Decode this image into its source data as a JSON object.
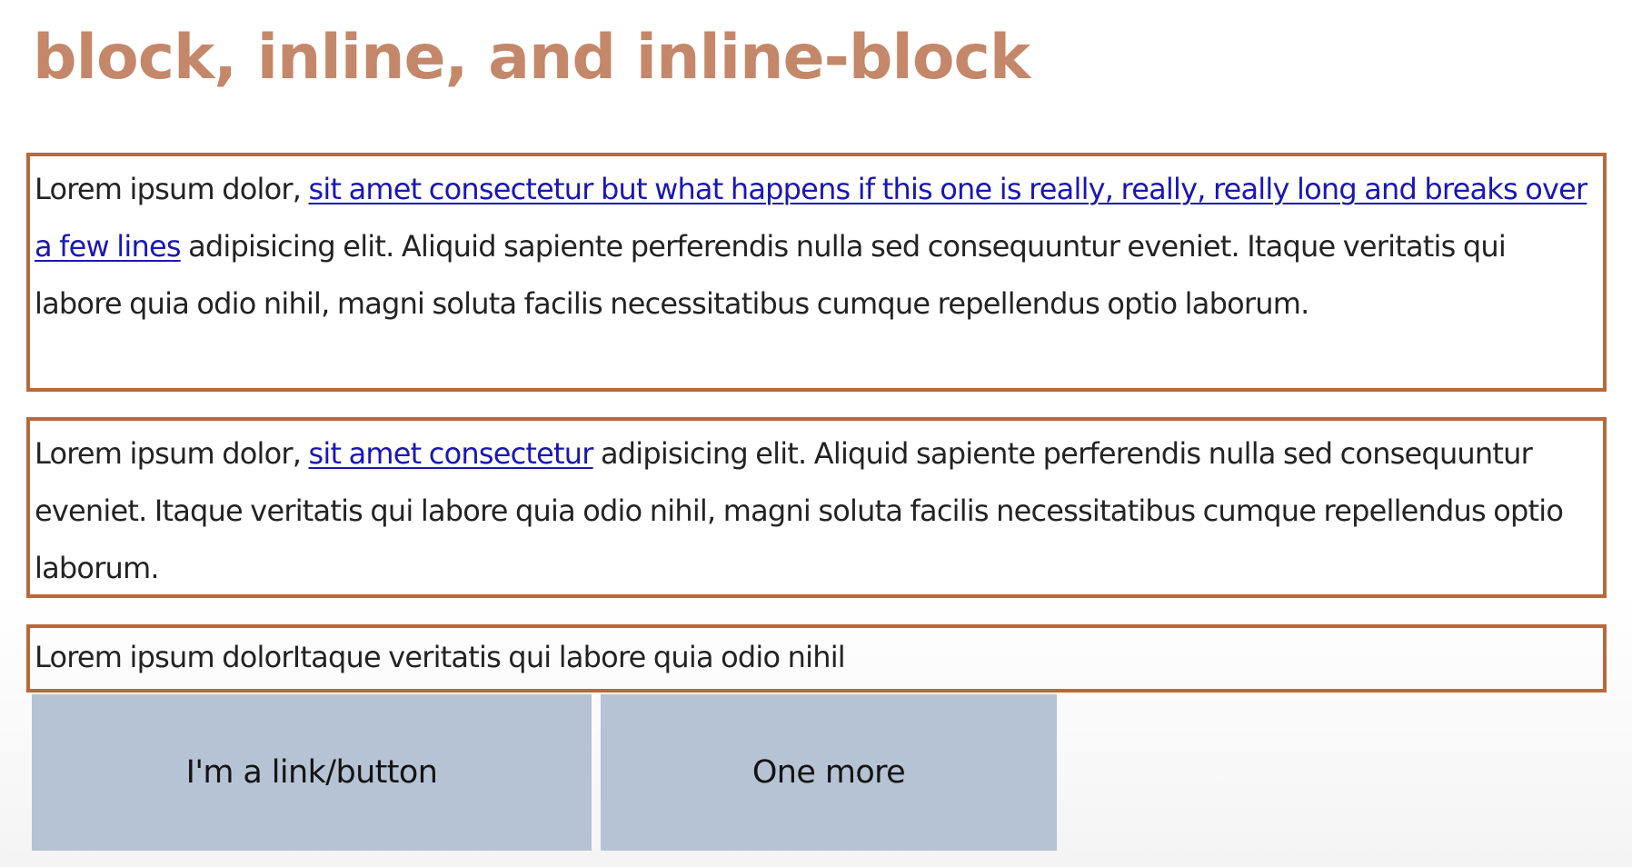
{
  "heading": "block, inline, and inline-block",
  "paragraph_1": {
    "text_before": "Lorem ipsum dolor, ",
    "link": "sit amet consectetur but what happens if this one is really, really, really long and breaks over a few lines",
    "text_after": " adipisicing elit. Aliquid sapiente perferendis nulla sed consequuntur eveniet. Itaque veritatis qui labore quia odio nihil, magni soluta facilis necessitatibus cumque repellendus optio laborum."
  },
  "paragraph_2": {
    "text_before": "Lorem ipsum dolor, ",
    "link": "sit amet consectetur",
    "text_after": " adipisicing elit. Aliquid sapiente perferendis nulla sed consequuntur eveniet. Itaque veritatis qui labore quia odio nihil, magni soluta facilis necessitatibus cumque repellendus optio laborum."
  },
  "paragraph_3": {
    "span_1": "Lorem ipsum dolor",
    "span_2": "Itaque veritatis qui labore quia odio nihil"
  },
  "buttons": [
    {
      "label": "I'm a link/button"
    },
    {
      "label": "One more"
    }
  ],
  "colors": {
    "heading": "#c4876a",
    "box_border": "#b8693a",
    "link": "#1a17b3",
    "button_background": "#b6c3d4"
  }
}
